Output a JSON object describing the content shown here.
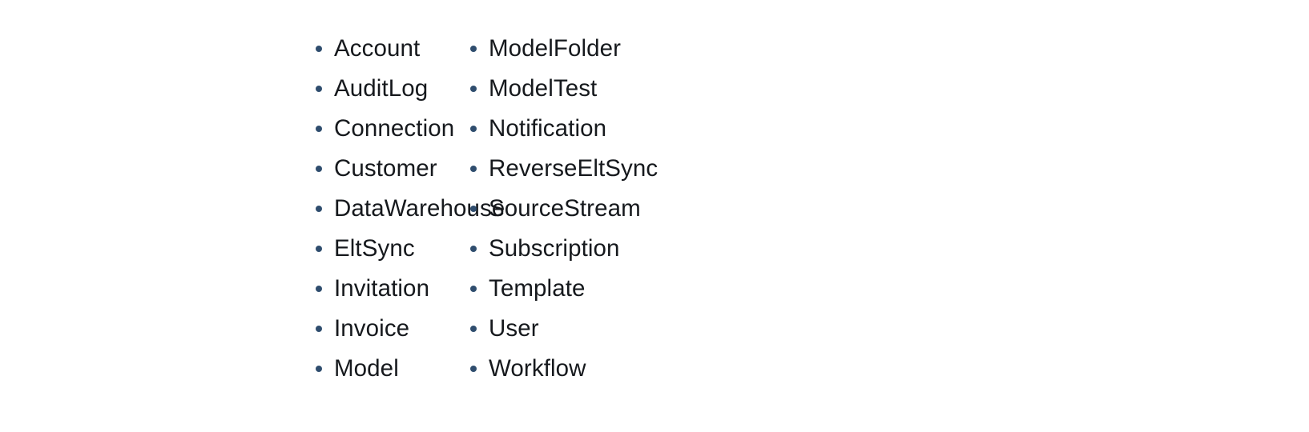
{
  "page": {
    "background_color": "#ffffff",
    "text_color": "#16191d",
    "bullet_color": "#2f4d6e"
  },
  "columns": [
    {
      "name": "left-column",
      "items": [
        {
          "label": "Account"
        },
        {
          "label": "AuditLog"
        },
        {
          "label": "Connection"
        },
        {
          "label": "Customer"
        },
        {
          "label": "DataWarehouse"
        },
        {
          "label": "EltSync"
        },
        {
          "label": "Invitation"
        },
        {
          "label": "Invoice"
        },
        {
          "label": "Model"
        }
      ]
    },
    {
      "name": "right-column",
      "items": [
        {
          "label": "ModelFolder"
        },
        {
          "label": "ModelTest"
        },
        {
          "label": "Notification"
        },
        {
          "label": "ReverseEltSync"
        },
        {
          "label": "SourceStream"
        },
        {
          "label": "Subscription"
        },
        {
          "label": "Template"
        },
        {
          "label": "User"
        },
        {
          "label": "Workflow"
        }
      ]
    }
  ]
}
